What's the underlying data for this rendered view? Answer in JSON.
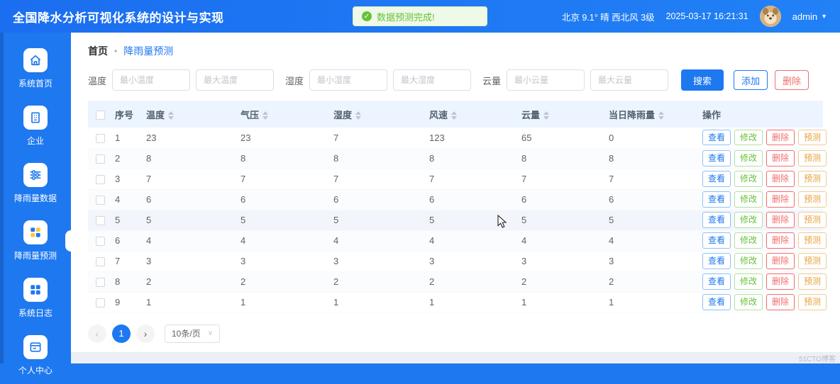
{
  "header": {
    "title": "全国降水分析可视化系统的设计与实现",
    "toast": "数据预测完成!",
    "weather": "北京 9.1° 晴 西北风 3级",
    "datetime": "2025-03-17 16:21:31",
    "user": "admin"
  },
  "sidebar": {
    "items": [
      {
        "name": "home",
        "label": "系统首页",
        "icon": "home-icon",
        "active": false
      },
      {
        "name": "enterprise",
        "label": "企业",
        "icon": "building-icon",
        "active": false
      },
      {
        "name": "rainfall-data",
        "label": "降雨量数据",
        "icon": "sliders-icon",
        "active": false
      },
      {
        "name": "rainfall-forecast",
        "label": "降雨量预测",
        "icon": "grid-color-icon",
        "active": true
      },
      {
        "name": "system-log",
        "label": "系统日志",
        "icon": "grid-icon",
        "active": false
      },
      {
        "name": "profile",
        "label": "个人中心",
        "icon": "card-icon",
        "active": false
      }
    ]
  },
  "breadcrumb": {
    "home": "首页",
    "current": "降雨量预测"
  },
  "filters": [
    {
      "label": "温度",
      "min_placeholder": "最小温度",
      "max_placeholder": "最大温度"
    },
    {
      "label": "湿度",
      "min_placeholder": "最小湿度",
      "max_placeholder": "最大湿度"
    },
    {
      "label": "云量",
      "min_placeholder": "最小云量",
      "max_placeholder": "最大云量"
    }
  ],
  "actions": {
    "search": "搜索",
    "add": "添加",
    "delete": "删除"
  },
  "table": {
    "columns": [
      {
        "label": "序号",
        "sortable": false
      },
      {
        "label": "温度",
        "sortable": true
      },
      {
        "label": "气压",
        "sortable": true
      },
      {
        "label": "湿度",
        "sortable": true
      },
      {
        "label": "风速",
        "sortable": true
      },
      {
        "label": "云量",
        "sortable": true
      },
      {
        "label": "当日降雨量",
        "sortable": true
      },
      {
        "label": "操作",
        "sortable": false
      }
    ],
    "rows": [
      [
        "1",
        "23",
        "23",
        "7",
        "123",
        "65",
        "0"
      ],
      [
        "2",
        "8",
        "8",
        "8",
        "8",
        "8",
        "8"
      ],
      [
        "3",
        "7",
        "7",
        "7",
        "7",
        "7",
        "7"
      ],
      [
        "4",
        "6",
        "6",
        "6",
        "6",
        "6",
        "6"
      ],
      [
        "5",
        "5",
        "5",
        "5",
        "5",
        "5",
        "5"
      ],
      [
        "6",
        "4",
        "4",
        "4",
        "4",
        "4",
        "4"
      ],
      [
        "7",
        "3",
        "3",
        "3",
        "3",
        "3",
        "3"
      ],
      [
        "8",
        "2",
        "2",
        "2",
        "2",
        "2",
        "2"
      ],
      [
        "9",
        "1",
        "1",
        "1",
        "1",
        "1",
        "1"
      ]
    ],
    "row_actions": [
      {
        "type": "view",
        "label": "查看"
      },
      {
        "type": "edit",
        "label": "修改"
      },
      {
        "type": "delete",
        "label": "删除"
      },
      {
        "type": "predict",
        "label": "预测"
      }
    ],
    "hover_row_index": 4
  },
  "pagination": {
    "prev": "‹",
    "current": "1",
    "next": "›",
    "page_size": "10条/页"
  },
  "watermark": "51CTO博客",
  "colors": {
    "primary": "#1e78f0",
    "success": "#67c23a",
    "danger": "#f56c6c",
    "warning": "#e6a23c",
    "table_header_bg": "#ecf5ff"
  }
}
